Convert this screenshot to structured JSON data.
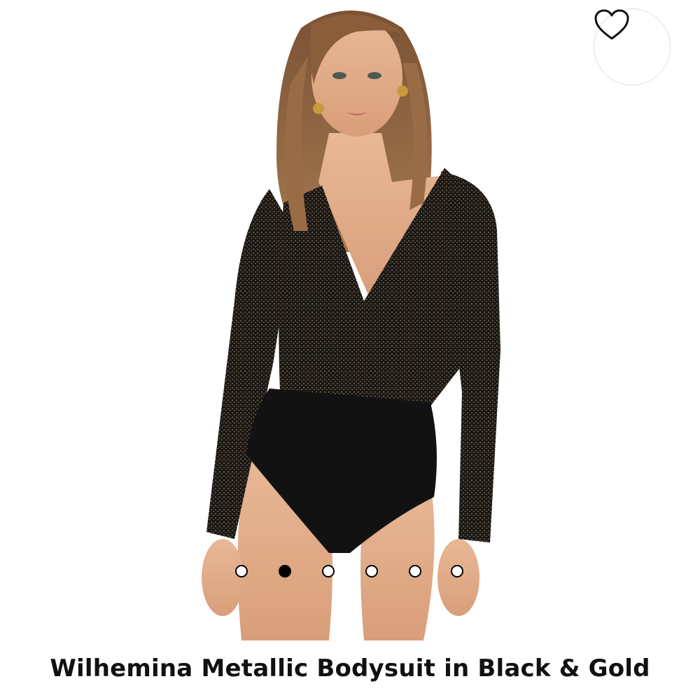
{
  "product": {
    "title": "Wilhemina Metallic Bodysuit in Black & Gold"
  },
  "favorite": {
    "icon": "heart-outline-icon"
  },
  "carousel": {
    "total_images": 6,
    "active_index": 1
  },
  "colors": {
    "background": "#ffffff",
    "dot_active": "#000000",
    "dot_border": "#000000",
    "title": "#111111"
  }
}
